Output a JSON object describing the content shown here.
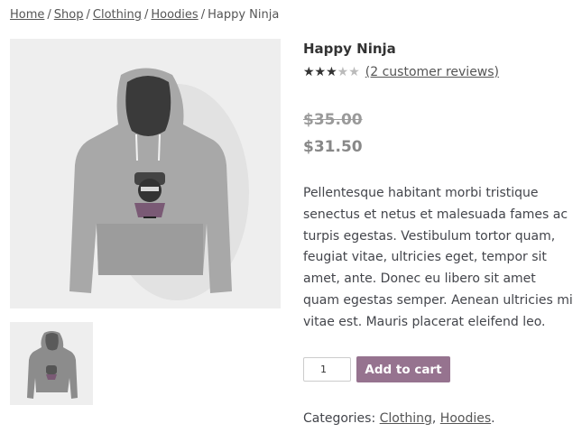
{
  "breadcrumb": {
    "items": [
      "Home",
      "Shop",
      "Clothing",
      "Hoodies"
    ],
    "separator": "/",
    "current": "Happy Ninja"
  },
  "product": {
    "title": "Happy Ninja",
    "rating": {
      "value": 3,
      "max": 5,
      "reviews_label": "(2 customer reviews)"
    },
    "price_old": "$35.00",
    "price_new": "$31.50",
    "description": "Pellentesque habitant morbi tristique senectus et netus et malesuada fames ac turpis egestas. Vestibulum tortor quam, feugiat vitae, ultricies eget, tempor sit amet, ante. Donec eu libero sit amet quam egestas semper. Aenean ultricies mi vitae est. Mauris placerat eleifend leo.",
    "quantity": "1",
    "add_to_cart_label": "Add to cart",
    "categories_label": "Categories:",
    "categories": [
      "Clothing",
      "Hoodies"
    ],
    "categories_sep": ",",
    "categories_end": "."
  },
  "colors": {
    "accent": "#96738f",
    "hoodie": "#a6a6a6",
    "image_bg": "#eeeeee",
    "price_muted": "#888888"
  },
  "icons": {
    "star": "star-icon",
    "hoodie_image": "hoodie-image",
    "hoodie_thumbnail": "hoodie-thumbnail"
  }
}
